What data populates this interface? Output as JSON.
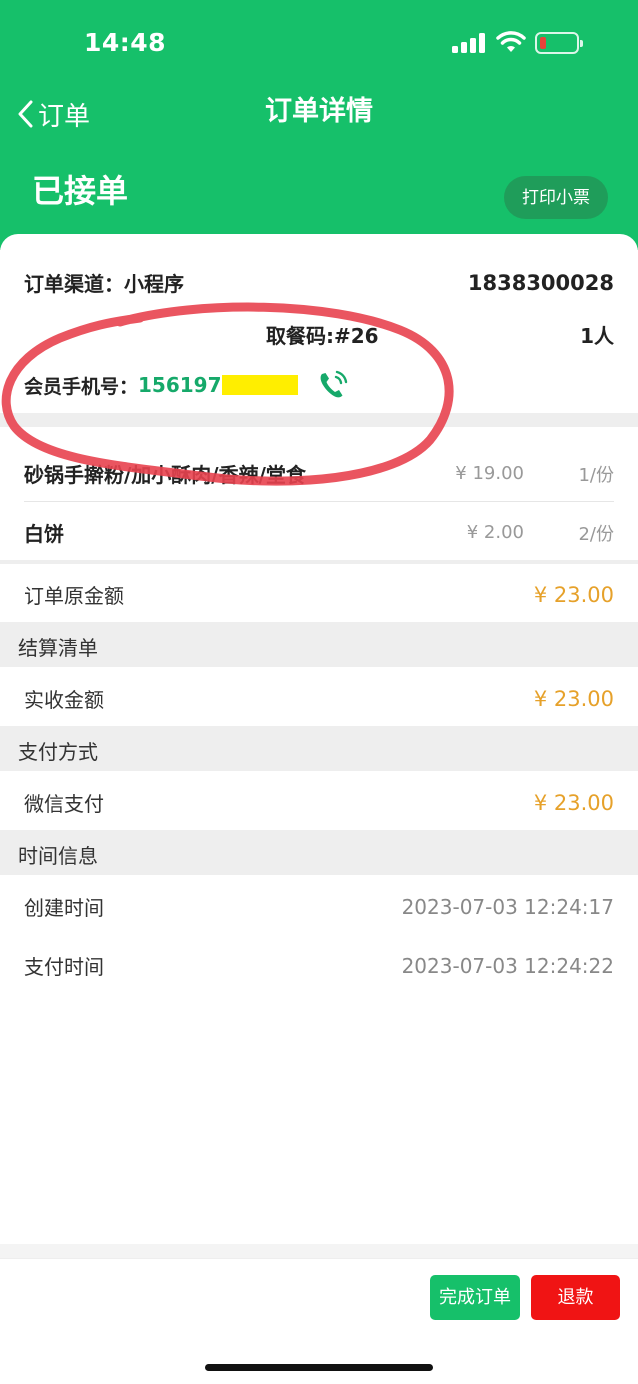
{
  "status_bar": {
    "time": "14:48"
  },
  "nav": {
    "back_label": "订单",
    "title": "订单详情"
  },
  "order": {
    "status": "已接单",
    "print_label": "打印小票",
    "channel_label": "订单渠道：小程序",
    "order_number": "1838300028",
    "pickup_code": "取餐码:#26",
    "people": "1人",
    "member_phone_label": "会员手机号：",
    "member_phone": "156197"
  },
  "items": [
    {
      "name": "砂锅手擀粉/加小酥肉/香辣/堂食",
      "price": "¥ 19.00",
      "qty": "1/份"
    },
    {
      "name": "白饼",
      "price": "¥ 2.00",
      "qty": "2/份"
    }
  ],
  "original_amount": {
    "label": "订单原金额",
    "value": "¥ 23.00"
  },
  "settlement": {
    "section": "结算清单",
    "label": "实收金额",
    "value": "¥ 23.00"
  },
  "payment": {
    "section": "支付方式",
    "label": "微信支付",
    "value": "¥ 23.00"
  },
  "time_info": {
    "section": "时间信息",
    "created_label": "创建时间",
    "created_value": "2023-07-03 12:24:17",
    "paid_label": "支付时间",
    "paid_value": "2023-07-03 12:24:22"
  },
  "footer": {
    "done_label": "完成订单",
    "refund_label": "退款"
  },
  "colors": {
    "brand": "#16c06a",
    "money": "#e6a12a",
    "refund": "#f01414",
    "annotation": "#e8434f"
  }
}
